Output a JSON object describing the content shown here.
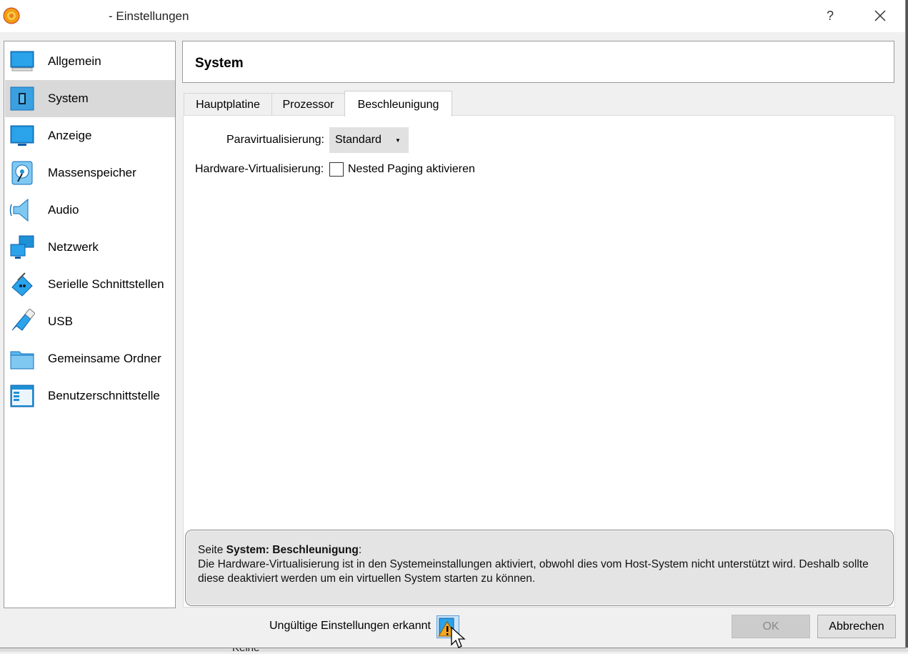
{
  "window": {
    "title": "- Einstellungen",
    "help_label": "?"
  },
  "sidebar": {
    "items": [
      {
        "label": "Allgemein",
        "icon": "general-monitor-icon"
      },
      {
        "label": "System",
        "icon": "system-chip-icon",
        "selected": true
      },
      {
        "label": "Anzeige",
        "icon": "display-icon"
      },
      {
        "label": "Massenspeicher",
        "icon": "storage-disk-icon"
      },
      {
        "label": "Audio",
        "icon": "audio-speaker-icon"
      },
      {
        "label": "Netzwerk",
        "icon": "network-icon"
      },
      {
        "label": "Serielle Schnittstellen",
        "icon": "serial-port-icon"
      },
      {
        "label": "USB",
        "icon": "usb-icon"
      },
      {
        "label": "Gemeinsame Ordner",
        "icon": "shared-folder-icon"
      },
      {
        "label": "Benutzerschnittstelle",
        "icon": "user-interface-icon"
      }
    ]
  },
  "page": {
    "title": "System",
    "tabs": [
      {
        "label": "Hauptplatine"
      },
      {
        "label": "Prozessor"
      },
      {
        "label": "Beschleunigung",
        "active": true
      }
    ],
    "paravirt_label": "Paravirtualisierung:",
    "paravirt_value": "Standard",
    "hwvirt_label": "Hardware-Virtualisierung:",
    "nested_paging_label": "Nested Paging aktivieren",
    "nested_paging_checked": false
  },
  "message": {
    "prefix": "Seite ",
    "page_name": "System: Beschleunigung",
    "colon": ":",
    "body": "Die Hardware-Virtualisierung ist in den Systemeinstallungen aktiviert, obwohl dies vom Host-System nicht unterstützt wird. Deshalb sollte diese deaktiviert werden um ein virtuellen System starten zu können."
  },
  "footer": {
    "warning_text": "Ungültige Einstellungen erkannt",
    "ok_label": "OK",
    "ok_enabled": false,
    "cancel_label": "Abbrechen"
  },
  "background": {
    "text": "Keine"
  },
  "colors": {
    "selected_bg": "#d9d9d9",
    "icon_blue": "#1e90d6",
    "warning": "#f5a623"
  }
}
